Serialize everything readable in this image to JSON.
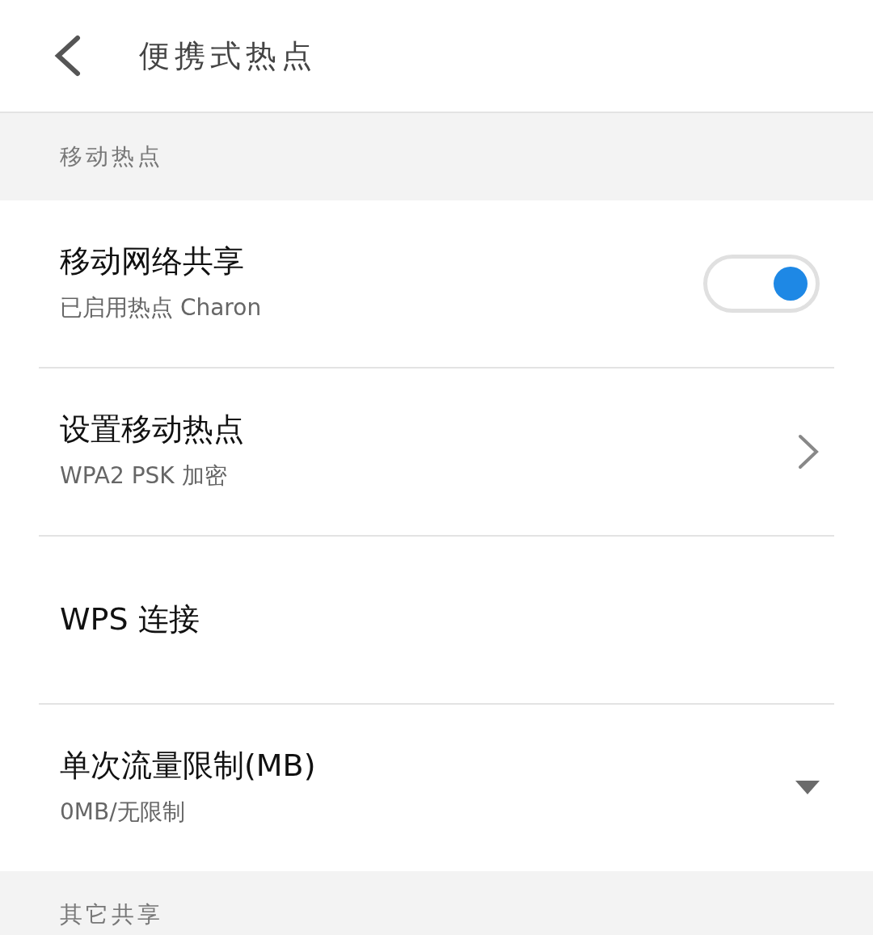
{
  "header": {
    "title": "便携式热点"
  },
  "sections": [
    {
      "title": "移动热点",
      "items": [
        {
          "kind": "toggle",
          "title": "移动网络共享",
          "subtitle": "已启用热点 Charon",
          "on": true
        },
        {
          "kind": "link",
          "title": "设置移动热点",
          "subtitle": "WPA2 PSK 加密"
        },
        {
          "kind": "plain",
          "title": "WPS 连接"
        },
        {
          "kind": "dropdown",
          "title": "单次流量限制(MB)",
          "subtitle": "0MB/无限制"
        }
      ]
    },
    {
      "title": "其它共享"
    }
  ]
}
